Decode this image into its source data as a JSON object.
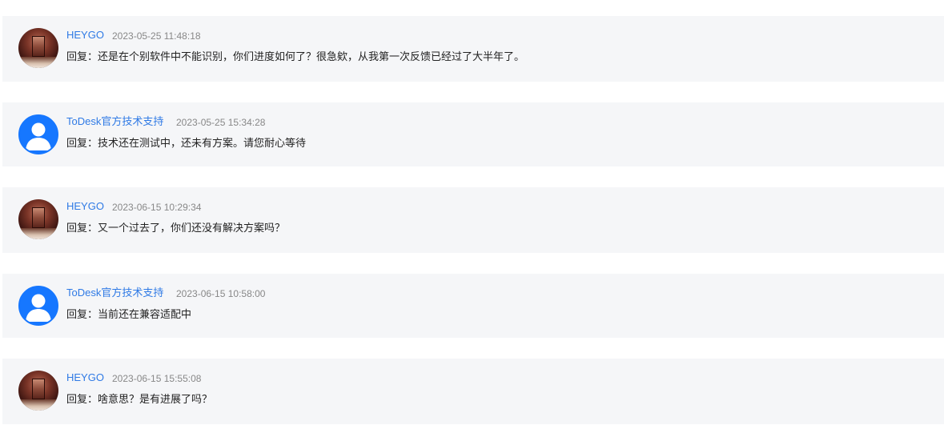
{
  "replies": [
    {
      "author": "HEYGO",
      "avatar": "user-photo-avatar",
      "time": "2023-05-25 11:48:18",
      "text": "回复：还是在个别软件中不能识别，你们进度如何了？很急欸，从我第一次反馈已经过了大半年了。"
    },
    {
      "author": "ToDesk官方技术支持",
      "avatar": "default-user-icon",
      "time": "2023-05-25 15:34:28",
      "text": "回复：技术还在测试中，还未有方案。请您耐心等待"
    },
    {
      "author": "HEYGO",
      "avatar": "user-photo-avatar",
      "time": "2023-06-15 10:29:34",
      "text": "回复：又一个过去了，你们还没有解决方案吗？"
    },
    {
      "author": "ToDesk官方技术支持",
      "avatar": "default-user-icon",
      "time": "2023-06-15 10:58:00",
      "text": "回复：当前还在兼容适配中"
    },
    {
      "author": "HEYGO",
      "avatar": "user-photo-avatar",
      "time": "2023-06-15 15:55:08",
      "text": "回复：啥意思？是有进展了吗？"
    }
  ],
  "colors": {
    "author": "#2f7ae5",
    "time": "#888888",
    "text": "#222222",
    "card_background": "#f5f6f8",
    "support_avatar": "#1677ff"
  }
}
